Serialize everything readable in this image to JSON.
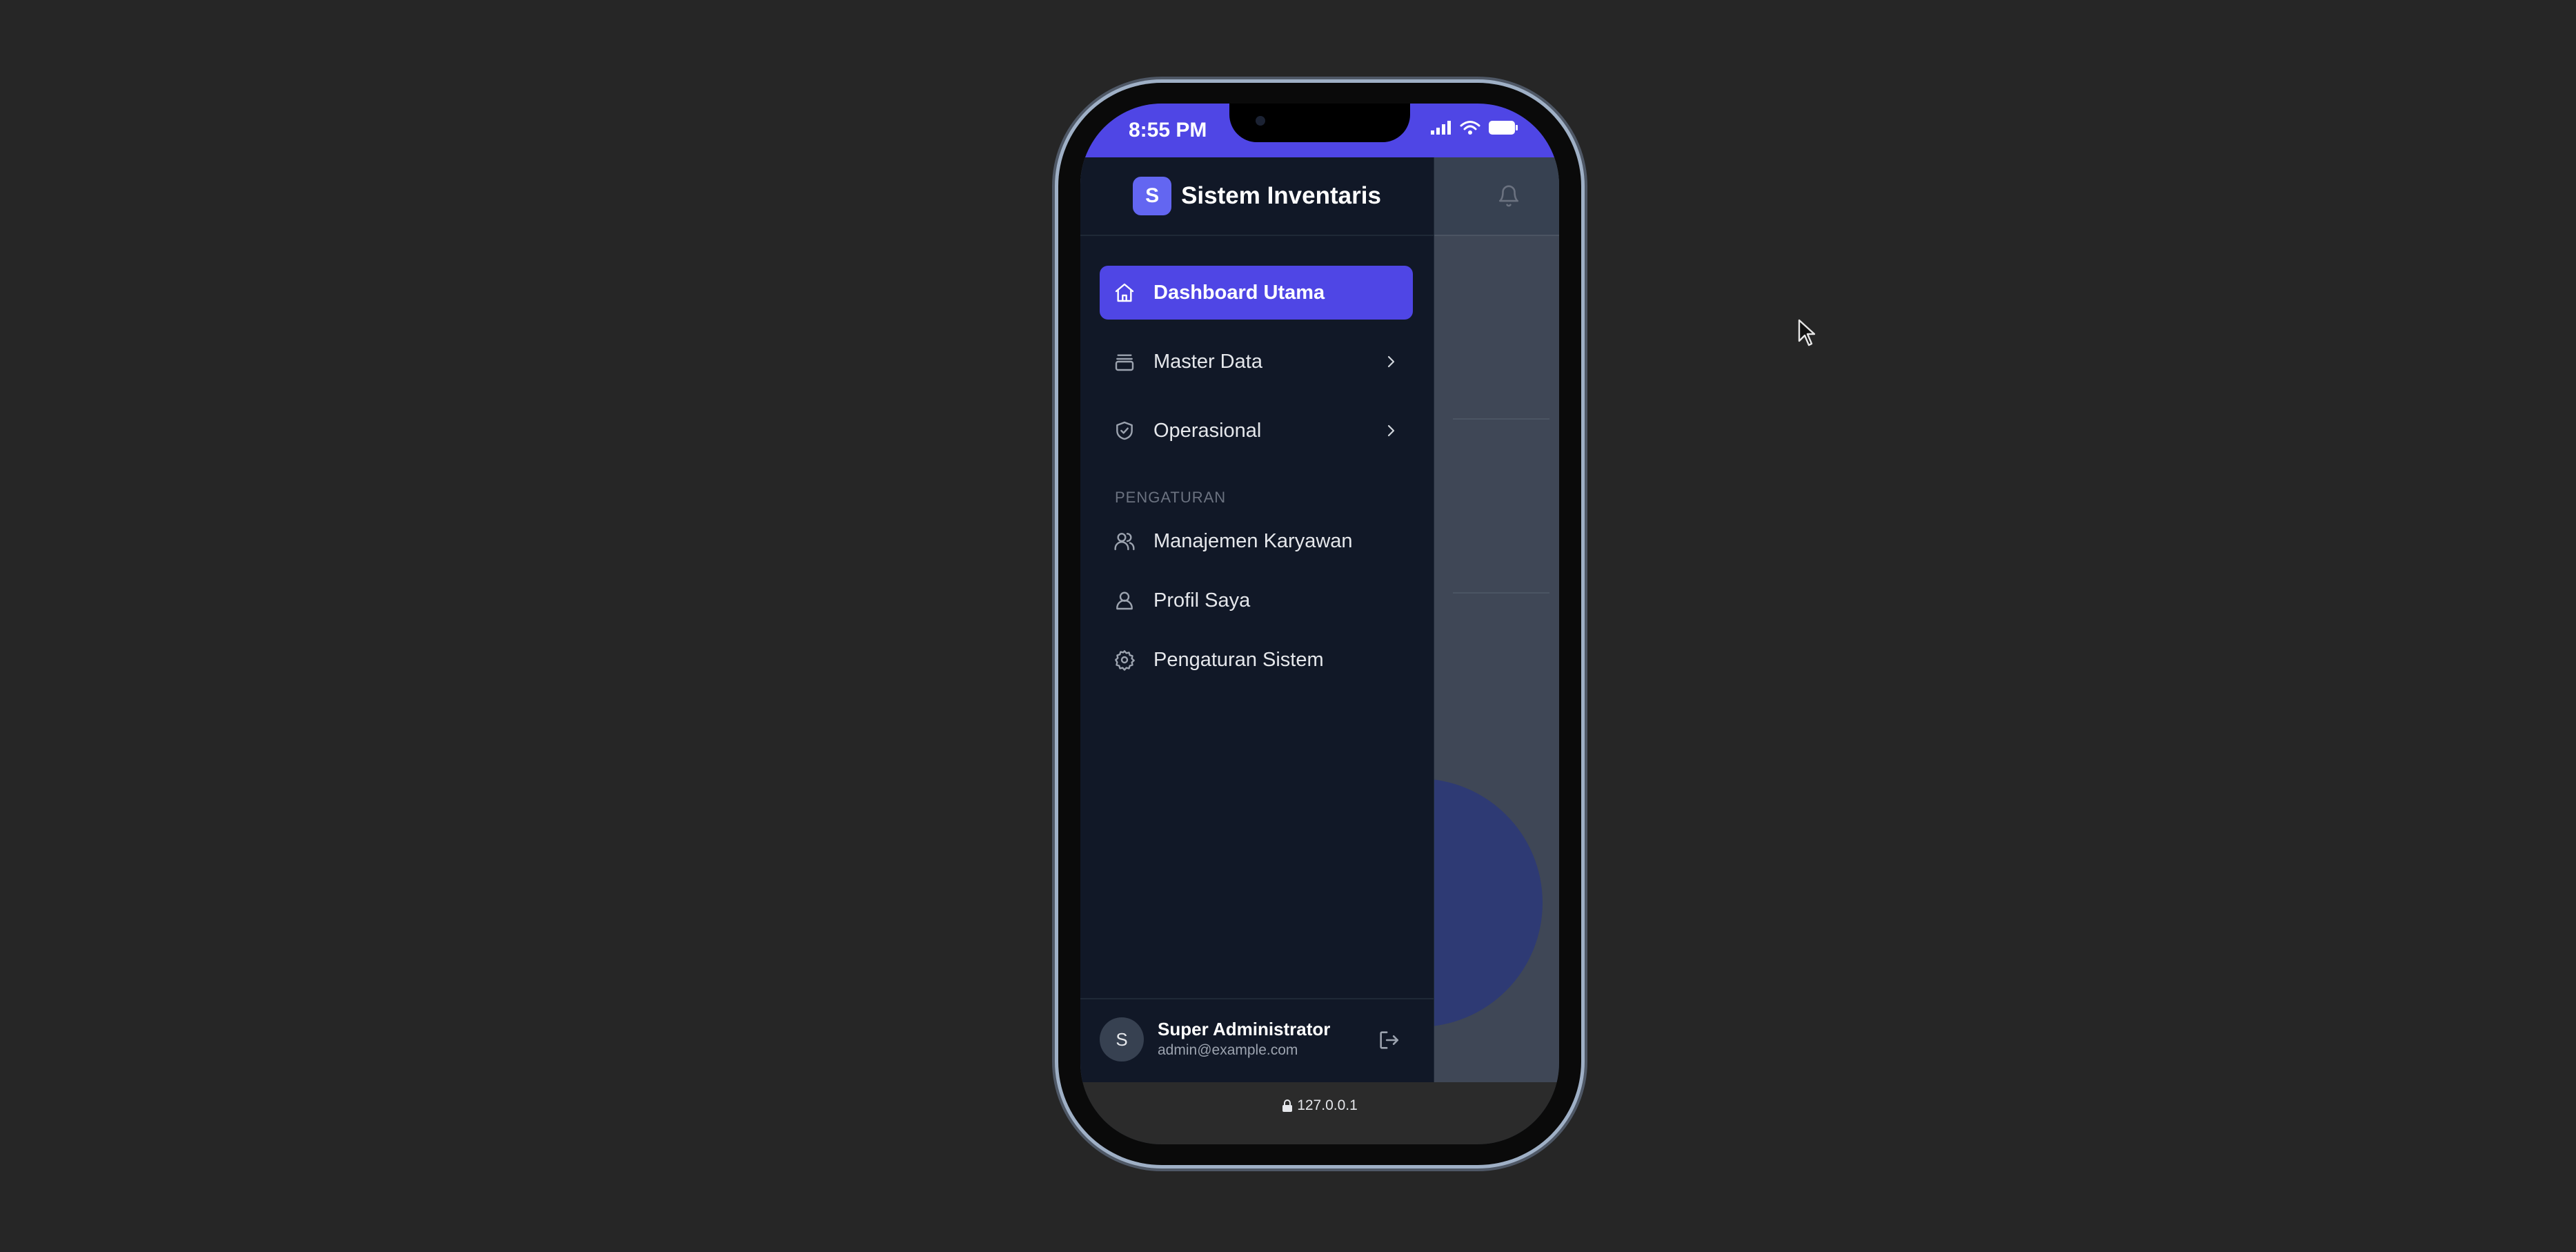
{
  "status_bar": {
    "time": "8:55 PM"
  },
  "app": {
    "brand_initial": "S",
    "brand_title": "Sistem Inventaris"
  },
  "nav": {
    "main": [
      {
        "label": "Dashboard Utama",
        "icon": "home-icon",
        "active": true
      },
      {
        "label": "Master Data",
        "icon": "archive-icon",
        "has_chevron": true
      },
      {
        "label": "Operasional",
        "icon": "shield-check-icon",
        "has_chevron": true
      }
    ],
    "section_title": "PENGATURAN",
    "settings": [
      {
        "label": "Manajemen Karyawan",
        "icon": "users-icon"
      },
      {
        "label": "Profil Saya",
        "icon": "user-icon"
      },
      {
        "label": "Pengaturan Sistem",
        "icon": "gear-icon"
      }
    ]
  },
  "user": {
    "initial": "S",
    "name": "Super Administrator",
    "email": "admin@example.com"
  },
  "browser": {
    "url": "127.0.0.1"
  },
  "colors": {
    "accent": "#4f46e5",
    "drawer_bg": "#111827",
    "page_bg": "#262626"
  }
}
